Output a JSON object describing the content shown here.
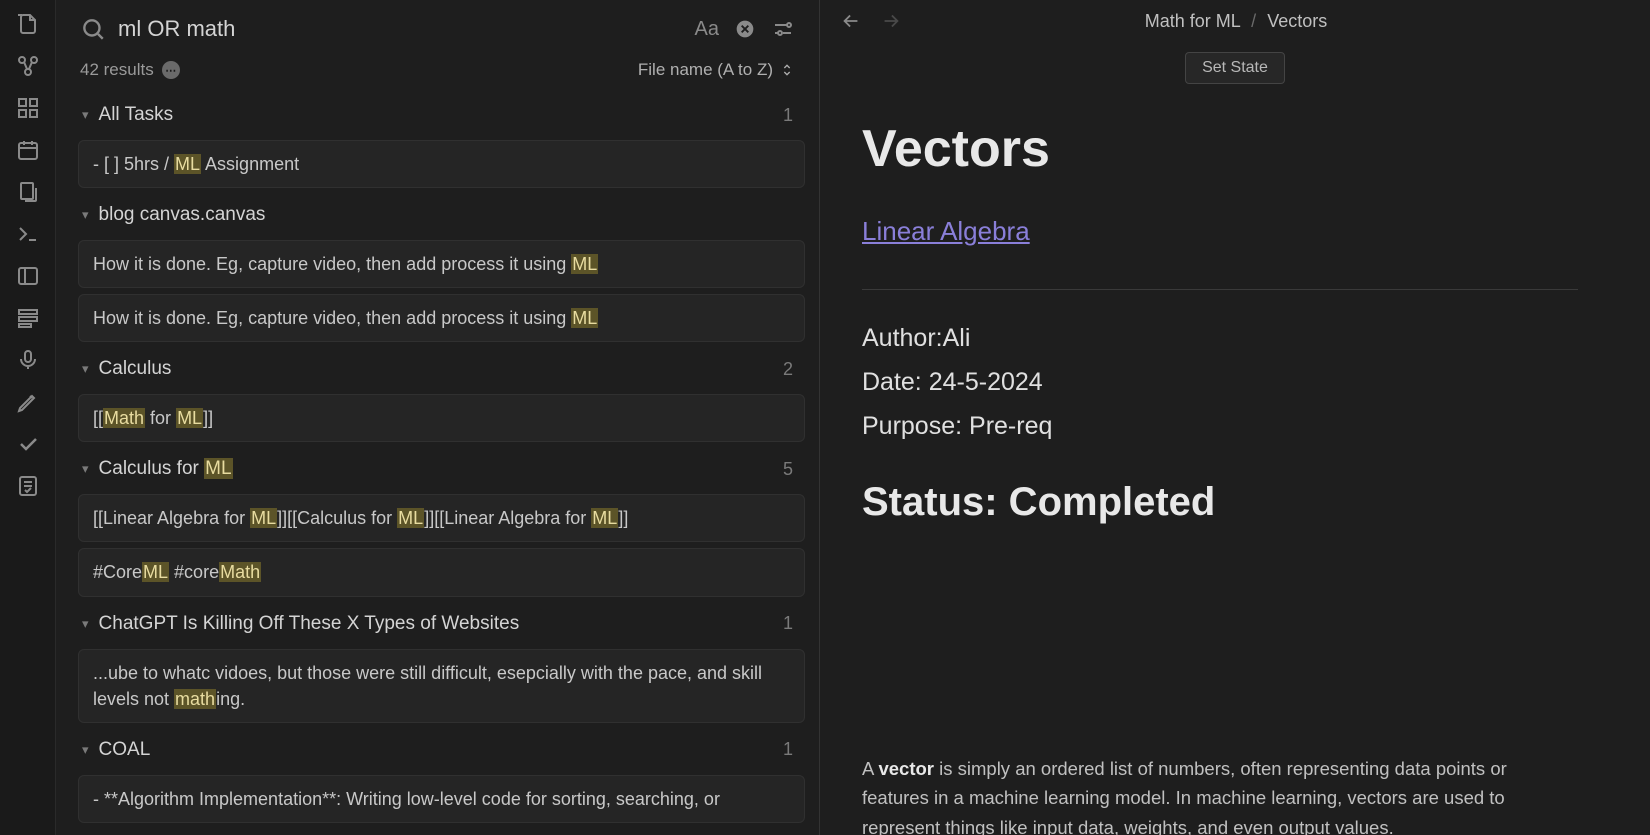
{
  "search": {
    "query": "ml OR math",
    "results_count": "42 results",
    "sort_label": "File name (A to Z)"
  },
  "results": [
    {
      "title": "All Tasks",
      "count": "1",
      "matches": [
        {
          "segments": [
            {
              "t": "- [ ] 5hrs / "
            },
            {
              "t": "ML",
              "hl": true
            },
            {
              "t": " Assignment"
            }
          ]
        }
      ]
    },
    {
      "title": "blog canvas.canvas",
      "count": "",
      "matches": [
        {
          "segments": [
            {
              "t": "How it is done. Eg, capture video, then add process it using "
            },
            {
              "t": "ML",
              "hl": true
            }
          ]
        },
        {
          "segments": [
            {
              "t": "How it is done. Eg, capture video, then add process it using "
            },
            {
              "t": "ML",
              "hl": true
            }
          ]
        }
      ]
    },
    {
      "title": "Calculus",
      "count": "2",
      "matches": [
        {
          "segments": [
            {
              "t": "[["
            },
            {
              "t": "Math",
              "hl": true
            },
            {
              "t": " for "
            },
            {
              "t": "ML",
              "hl": true
            },
            {
              "t": "]]"
            }
          ]
        }
      ]
    },
    {
      "title_segments": [
        {
          "t": "Calculus for "
        },
        {
          "t": "ML",
          "hl": true
        }
      ],
      "count": "5",
      "matches": [
        {
          "segments": [
            {
              "t": "[[Linear Algebra for "
            },
            {
              "t": "ML",
              "hl": true
            },
            {
              "t": "]][[Calculus for "
            },
            {
              "t": "ML",
              "hl": true
            },
            {
              "t": "]][[Linear Algebra for "
            },
            {
              "t": "ML",
              "hl": true
            },
            {
              "t": "]]"
            }
          ]
        },
        {
          "segments": [
            {
              "t": "#Core"
            },
            {
              "t": "ML",
              "hl": true
            },
            {
              "t": " #core"
            },
            {
              "t": "Math",
              "hl": true
            }
          ]
        }
      ]
    },
    {
      "title": "ChatGPT Is Killing Off These X Types of Websites",
      "count": "1",
      "matches": [
        {
          "segments": [
            {
              "t": "...ube to whatc vidoes, but those were still difficult, esepcially with the pace, and skill levels not "
            },
            {
              "t": "math",
              "hl": true
            },
            {
              "t": "ing."
            }
          ]
        }
      ]
    },
    {
      "title": "COAL",
      "count": "1",
      "matches": [
        {
          "segments": [
            {
              "t": "- **Algorithm Implementation**: Writing low-level code for sorting, searching, or"
            }
          ]
        }
      ]
    }
  ],
  "content": {
    "bc_parent": "Math for ML",
    "bc_current": "Vectors",
    "set_state": "Set State",
    "h1": "Vectors",
    "link": "Linear Algebra",
    "author_label": "Author:",
    "author_value": "Ali",
    "date_label": "Date:",
    "date_value": "24-5-2024",
    "purpose_label": "Purpose:",
    "purpose_value": "Pre-req",
    "status": "Status: Completed",
    "body_prefix": "A ",
    "body_bold": "vector",
    "body_rest": " is simply an ordered list of numbers, often representing data points or features in a machine learning model. In machine learning, vectors are used to represent things like input data, weights, and even output values."
  }
}
